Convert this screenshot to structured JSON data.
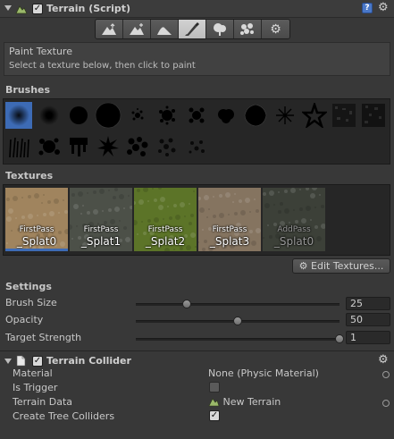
{
  "terrain_header": {
    "title": "Terrain (Script)",
    "enabled": true
  },
  "toolbar": {
    "tools": [
      {
        "icon": "raise-lower-terrain-icon"
      },
      {
        "icon": "paint-height-icon"
      },
      {
        "icon": "smooth-height-icon"
      },
      {
        "icon": "paint-texture-icon",
        "active": true
      },
      {
        "icon": "place-trees-icon"
      },
      {
        "icon": "paint-details-icon"
      },
      {
        "icon": "terrain-settings-icon"
      }
    ]
  },
  "info": {
    "title": "Paint Texture",
    "description": "Select a texture below, then click to paint"
  },
  "brushes_label": "Brushes",
  "textures": {
    "label": "Textures",
    "items": [
      {
        "top": "FirstPass",
        "bottom": "_Splat0",
        "color": "#a0845e",
        "selected": true
      },
      {
        "top": "FirstPass",
        "bottom": "_Splat1",
        "color": "#4c5048"
      },
      {
        "top": "FirstPass",
        "bottom": "_Splat2",
        "color": "#5c7428"
      },
      {
        "top": "FirstPass",
        "bottom": "_Splat3",
        "color": "#857460"
      },
      {
        "top": "AddPass",
        "bottom": "_Splat0",
        "color": "#3c4038",
        "dim": true
      }
    ],
    "edit_button": "Edit Textures..."
  },
  "settings": {
    "label": "Settings",
    "rows": [
      {
        "label": "Brush Size",
        "value": "25",
        "fraction": 0.25
      },
      {
        "label": "Opacity",
        "value": "50",
        "fraction": 0.5
      },
      {
        "label": "Target Strength",
        "value": "1",
        "fraction": 1.0
      }
    ]
  },
  "collider": {
    "title": "Terrain Collider",
    "enabled": true,
    "material_label": "Material",
    "material_value": "None (Physic Material)",
    "trigger_label": "Is Trigger",
    "is_trigger": false,
    "data_label": "Terrain Data",
    "data_value": "New Terrain",
    "tree_label": "Create Tree Colliders",
    "create_tree_colliders": true
  }
}
